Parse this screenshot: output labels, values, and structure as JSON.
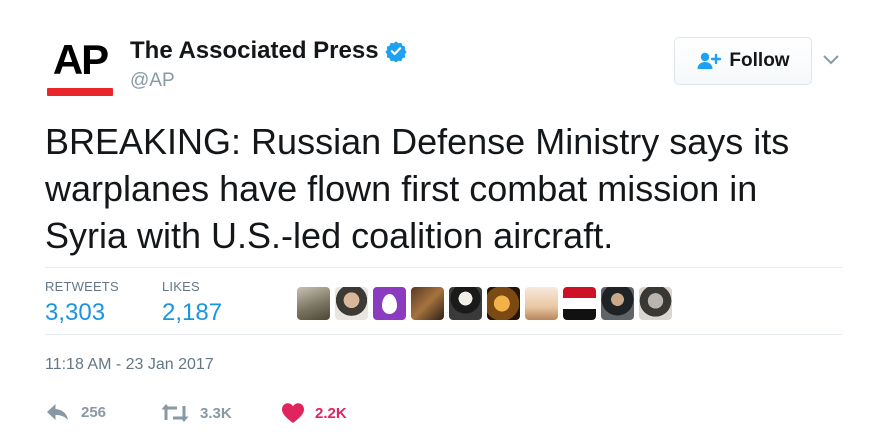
{
  "account": {
    "logo_text": "AP",
    "display_name": "The Associated Press",
    "handle": "@AP",
    "verified": true
  },
  "follow_button": {
    "label": "Follow"
  },
  "tweet": {
    "text": "BREAKING: Russian Defense Ministry says its warplanes have flown first combat mission in Syria with U.S.-led coalition aircraft.",
    "timestamp": "11:18 AM - 23 Jan 2017"
  },
  "stats": {
    "retweets_label": "RETWEETS",
    "retweets_value": "3,303",
    "likes_label": "LIKES",
    "likes_value": "2,187"
  },
  "actions": {
    "reply_count": "256",
    "retweet_count": "3.3K",
    "like_count": "2.2K"
  },
  "colors": {
    "link_blue": "#1b95e0",
    "verified_blue": "#1da1f2",
    "like_red": "#e0245e",
    "ap_red": "#e8262b",
    "muted_gray": "#8899a6"
  },
  "icons": [
    "verified-badge-icon",
    "follow-person-plus-icon",
    "chevron-down-icon",
    "reply-icon",
    "retweet-icon",
    "heart-icon"
  ]
}
